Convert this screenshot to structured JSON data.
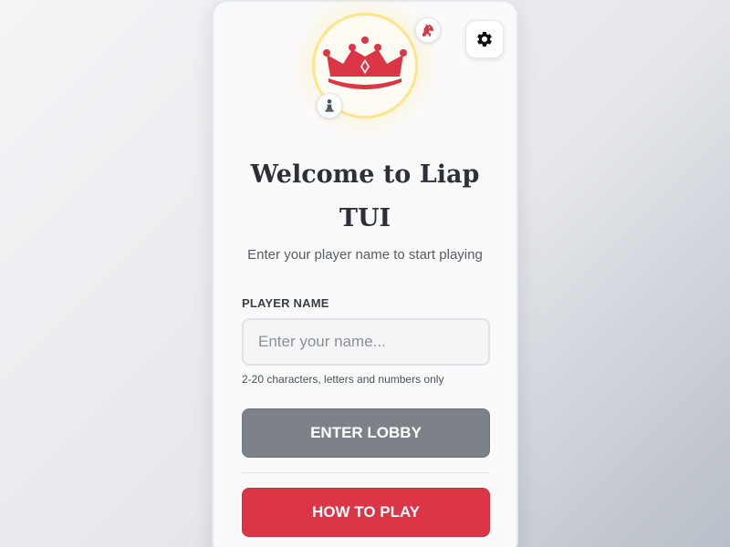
{
  "settings": {
    "icon": "gear-icon"
  },
  "logo": {
    "icon": "crown-icon",
    "badges": [
      "knight-icon",
      "pawn-icon"
    ],
    "accent_color": "#dc3545",
    "ring_color": "#fde68a"
  },
  "welcome": {
    "title": "Welcome to Liap TUI",
    "subtitle": "Enter your player name to start playing"
  },
  "form": {
    "label": "PLAYER NAME",
    "placeholder": "Enter your name...",
    "value": "",
    "hint": "2-20 characters, letters and numbers only"
  },
  "buttons": {
    "enter_lobby": "ENTER LOBBY",
    "how_to_play": "HOW TO PLAY"
  },
  "colors": {
    "primary": "#dc3545",
    "disabled_button": "#7d8289",
    "title_text": "#2d3036"
  }
}
